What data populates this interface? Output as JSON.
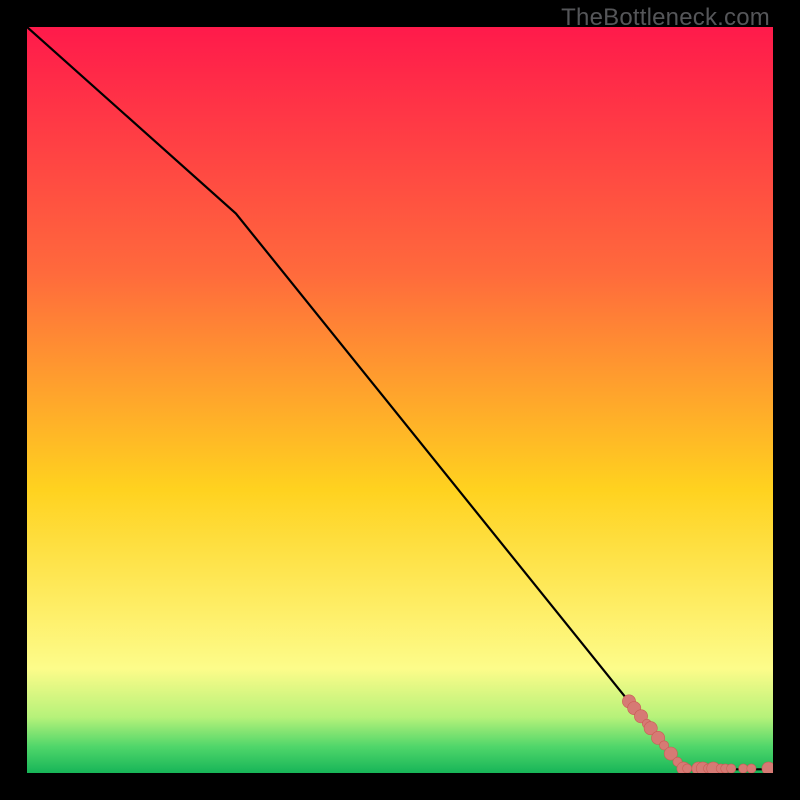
{
  "watermark": "TheBottleneck.com",
  "colors": {
    "line": "#000000",
    "dot_fill": "#d67a74",
    "dot_stroke": "#c95c55",
    "grad_top": "#ff1a4b",
    "grad_q1": "#ff6a3c",
    "grad_mid": "#ffd21f",
    "grad_low": "#fdfc8a",
    "grad_green_top": "#b6f27a",
    "grad_green_mid": "#4fd66a",
    "grad_green_bot": "#17b558",
    "border": "#000000"
  },
  "chart_data": {
    "type": "line",
    "title": "",
    "xlabel": "",
    "ylabel": "",
    "xlim": [
      0,
      100
    ],
    "ylim": [
      0,
      100
    ],
    "series": [
      {
        "name": "curve",
        "x": [
          0,
          28,
          88,
          100
        ],
        "y": [
          100,
          75,
          0.5,
          0.5
        ]
      }
    ],
    "points": {
      "name": "markers",
      "x": [
        80.7,
        81.4,
        82.3,
        83.1,
        83.6,
        84.6,
        85.4,
        86.3,
        87.2,
        88.0,
        88.5,
        90.0,
        90.6,
        91.3,
        92.0,
        93.0,
        93.6,
        94.4,
        96.0,
        97.1,
        99.4
      ],
      "y": [
        9.6,
        8.7,
        7.6,
        6.6,
        6.0,
        4.7,
        3.7,
        2.6,
        1.5,
        0.6,
        0.6,
        0.6,
        0.6,
        0.6,
        0.6,
        0.6,
        0.6,
        0.6,
        0.6,
        0.6,
        0.6
      ],
      "r_big_idx": [
        0,
        1,
        2,
        4,
        5,
        7,
        9,
        11,
        12,
        14,
        20
      ],
      "r_small_idx": [
        3,
        6,
        8,
        10,
        13,
        15,
        16,
        17,
        18,
        19
      ]
    },
    "gradient_stops": [
      {
        "pos": 0.0,
        "key": "grad_top"
      },
      {
        "pos": 0.33,
        "key": "grad_q1"
      },
      {
        "pos": 0.62,
        "key": "grad_mid"
      },
      {
        "pos": 0.86,
        "key": "grad_low"
      },
      {
        "pos": 0.925,
        "key": "grad_green_top"
      },
      {
        "pos": 0.965,
        "key": "grad_green_mid"
      },
      {
        "pos": 1.0,
        "key": "grad_green_bot"
      }
    ]
  }
}
